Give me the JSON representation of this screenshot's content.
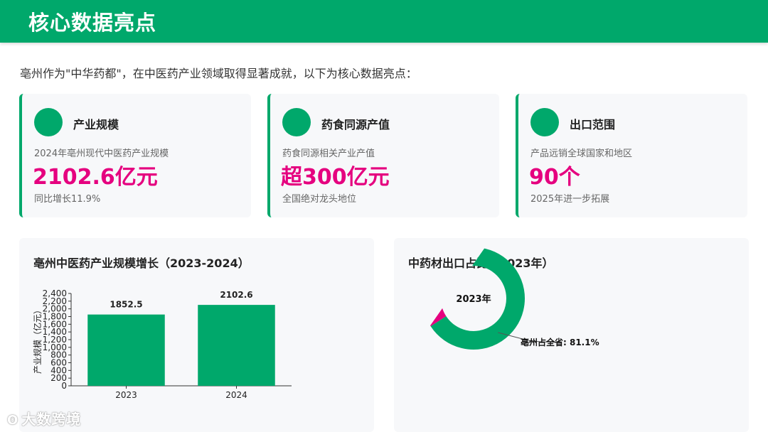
{
  "header": {
    "title": "核心数据亮点"
  },
  "intro": "亳州作为\"中华药都\"，在中医药产业领域取得显著成就，以下为核心数据亮点：",
  "cards": [
    {
      "title": "产业规模",
      "desc": "2024年亳州现代中医药产业规模",
      "value": "2102.6亿元",
      "note": "同比增长11.9%"
    },
    {
      "title": "药食同源产值",
      "desc": "药食同源相关产业产值",
      "value": "超300亿元",
      "note": "全国绝对龙头地位"
    },
    {
      "title": "出口范围",
      "desc": "产品远销全球国家和地区",
      "value": "90个",
      "note": "2025年进一步拓展"
    }
  ],
  "colors": {
    "green": "#00a86b",
    "magenta": "#e5007f"
  },
  "chart_data": [
    {
      "type": "bar",
      "title": "亳州中医药产业规模增长（2023-2024）",
      "categories": [
        "2023",
        "2024"
      ],
      "values": [
        1852.5,
        2102.6
      ],
      "value_labels": [
        "1852.5",
        "2102.6"
      ],
      "ylabel": "产业规模（亿元）",
      "ylim": [
        0,
        2400
      ],
      "yticks": [
        0,
        200,
        400,
        600,
        800,
        1000,
        1200,
        1400,
        1600,
        1800,
        2000,
        2200,
        2400
      ],
      "ytick_labels": [
        "0",
        "200",
        "400",
        "600",
        "800",
        "1,000",
        "1,200",
        "1,400",
        "1,600",
        "1,800",
        "2,000",
        "2,200",
        "2,400"
      ],
      "grid": false
    },
    {
      "type": "pie",
      "title": "中药材出口占比（2023年）",
      "center_label": "2023年",
      "slices": [
        {
          "label": "亳州占全省: 81.1%",
          "value": 81.1,
          "color": "#00a86b"
        },
        {
          "value": 18.9,
          "color": "#e5007f"
        }
      ]
    }
  ],
  "watermark": "大数跨境"
}
